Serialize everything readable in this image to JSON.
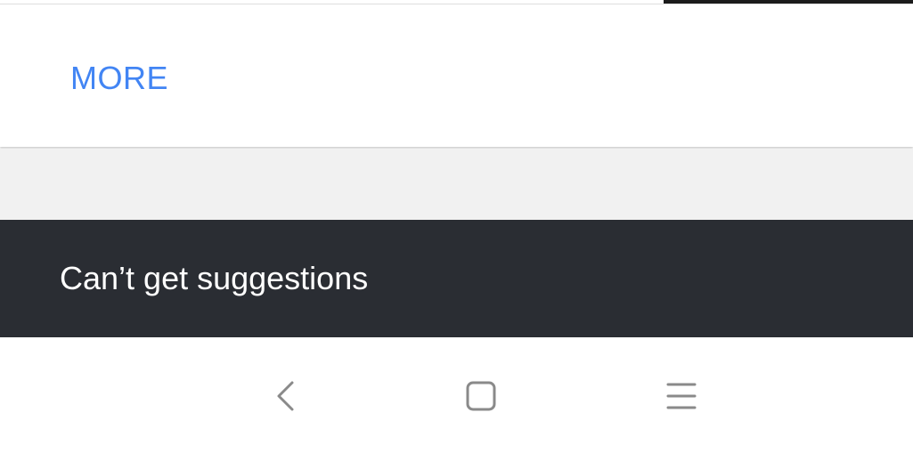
{
  "card": {
    "more_label": "MORE"
  },
  "snackbar": {
    "message": "Can’t get suggestions"
  },
  "navigation_bar": {
    "buttons": [
      {
        "icon": "back-icon"
      },
      {
        "icon": "home-icon"
      },
      {
        "icon": "recents-icon"
      }
    ]
  },
  "colors": {
    "accent": "#4285f4",
    "snackbar_background": "#2a2d33",
    "gap_background": "#f1f1f1",
    "nav_icon": "#8a8a8a"
  }
}
